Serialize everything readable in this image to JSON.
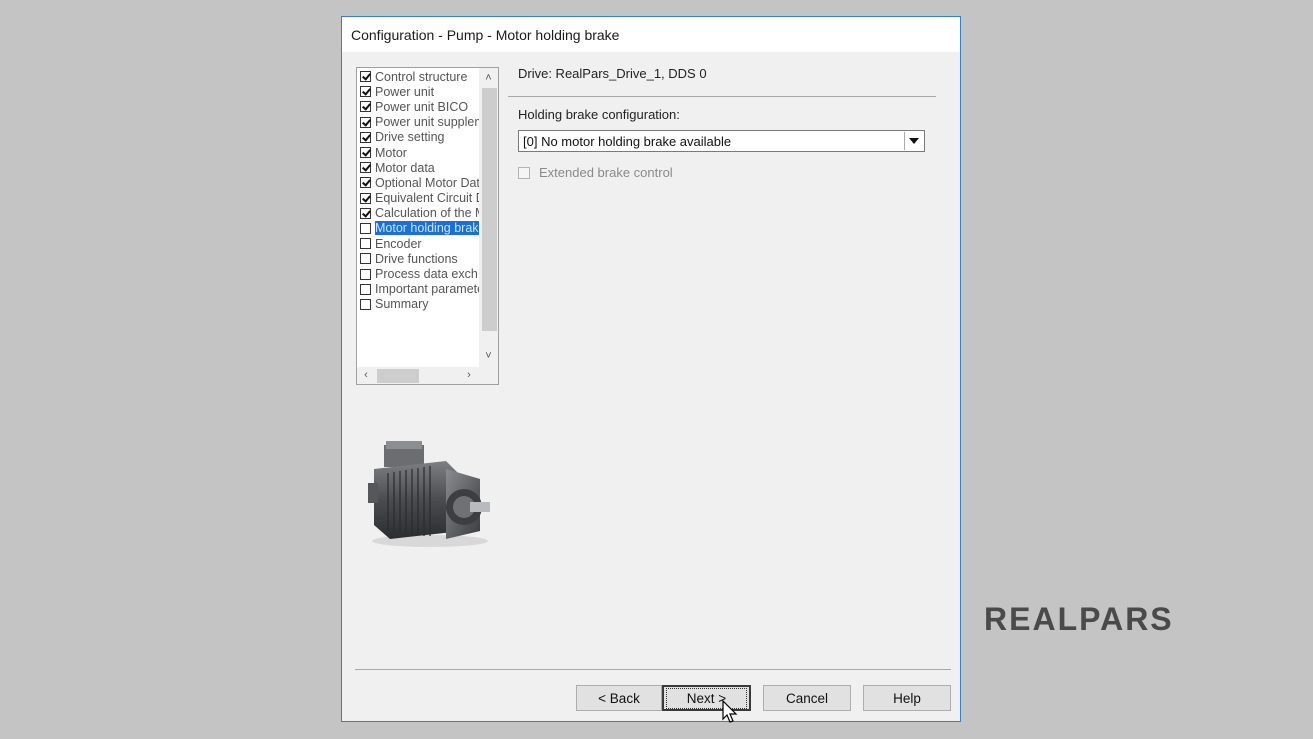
{
  "window": {
    "title": "Configuration - Pump - Motor holding brake"
  },
  "tree": {
    "items": [
      {
        "label": "Control structure",
        "checked": true
      },
      {
        "label": "Power unit",
        "checked": true
      },
      {
        "label": "Power unit BICO",
        "checked": true
      },
      {
        "label": "Power unit supplem",
        "checked": true
      },
      {
        "label": "Drive setting",
        "checked": true
      },
      {
        "label": "Motor",
        "checked": true
      },
      {
        "label": "Motor data",
        "checked": true
      },
      {
        "label": "Optional Motor Dat",
        "checked": true
      },
      {
        "label": "Equivalent Circuit D",
        "checked": true
      },
      {
        "label": "Calculation of the M",
        "checked": true
      },
      {
        "label": "Motor holding brak",
        "checked": false,
        "selected": true
      },
      {
        "label": "Encoder",
        "checked": false
      },
      {
        "label": "Drive functions",
        "checked": false
      },
      {
        "label": "Process data exch",
        "checked": false
      },
      {
        "label": "Important paramete",
        "checked": false
      },
      {
        "label": "Summary",
        "checked": false
      }
    ]
  },
  "main": {
    "drive_label": "Drive: RealPars_Drive_1, DDS 0",
    "holding_brake_label": "Holding brake configuration:",
    "holding_brake_value": "[0] No motor holding brake available",
    "extended_brake_label": "Extended brake control"
  },
  "buttons": {
    "back": "< Back",
    "next": "Next >",
    "cancel": "Cancel",
    "help": "Help"
  },
  "brand": {
    "name": "REALPARS"
  },
  "colors": {
    "selection": "#1a6fd8",
    "window_border": "#3b7bd0",
    "background": "#c4c4c4"
  }
}
